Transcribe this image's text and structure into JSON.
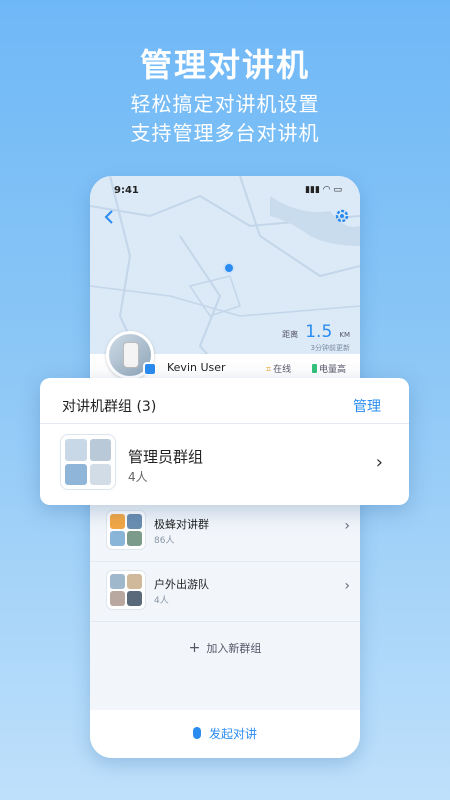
{
  "hero": {
    "title": "管理对讲机",
    "subtitle_1": "轻松搞定对讲机设置",
    "subtitle_2": "支持管理多台对讲机"
  },
  "phone": {
    "status_time": "9:41",
    "map": {
      "distance_label": "距离",
      "distance_value": "1.5",
      "distance_unit": "KM",
      "updated": "3分钟前更新"
    },
    "user": {
      "name": "Kevin User",
      "online": "在线",
      "battery": "电量高"
    },
    "groups": [
      {
        "name": "极蜂对讲群",
        "count": "86人"
      },
      {
        "name": "户外出游队",
        "count": "4人"
      }
    ],
    "add_group": "加入新群组",
    "talk_button": "发起对讲"
  },
  "card": {
    "title": "对讲机群组 (3)",
    "manage": "管理",
    "group_name": "管理员群组",
    "group_count": "4人"
  },
  "colors": {
    "accent": "#2a8cf0",
    "bg_top": "#6fb8f7",
    "bg_bottom": "#bfe0fb"
  }
}
